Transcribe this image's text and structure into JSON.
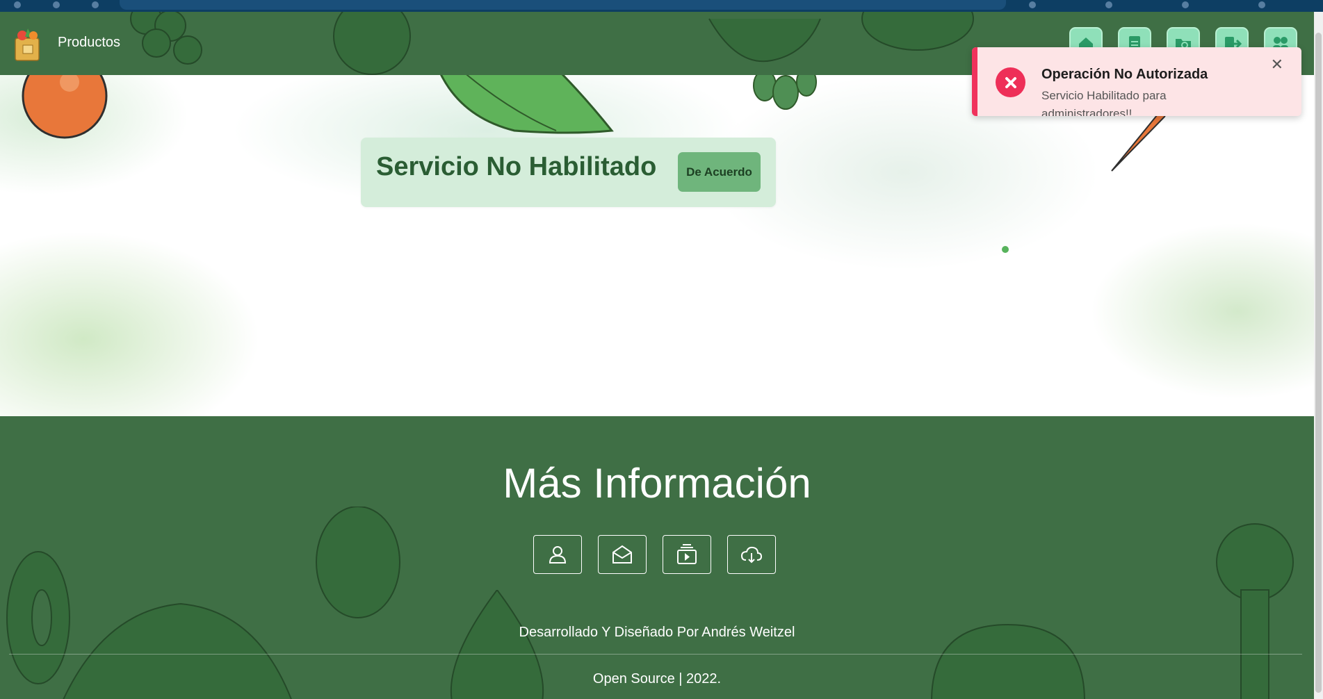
{
  "navbar": {
    "brand": "Productos",
    "buttons": [
      {
        "name": "home-icon"
      },
      {
        "name": "document-icon"
      },
      {
        "name": "folder-search-icon"
      },
      {
        "name": "logout-icon"
      },
      {
        "name": "users-icon"
      }
    ]
  },
  "alert": {
    "title": "Servicio No Habilitado",
    "button_label": "De Acuerdo"
  },
  "toast": {
    "title": "Operación No Autorizada",
    "message": "Servicio Habilitado para administradores!!",
    "close_label": "✕"
  },
  "footer": {
    "title": "Más Información",
    "social": [
      {
        "name": "user-icon"
      },
      {
        "name": "envelope-open-icon"
      },
      {
        "name": "video-playlist-icon"
      },
      {
        "name": "cloud-download-icon"
      }
    ],
    "credit": "Desarrollado Y Diseñado Por Andrés Weitzel",
    "copyright": "Open Source | 2022."
  },
  "colors": {
    "navbar_bg": "#3f6f45",
    "footer_bg": "#3f6f45",
    "alert_bg": "#d4edda",
    "alert_title": "#2a5d33",
    "alert_button": "#6fb57c",
    "nav_button": "#8fe0b9",
    "toast_bg": "#fde4e6",
    "toast_accent": "#f0325c"
  }
}
